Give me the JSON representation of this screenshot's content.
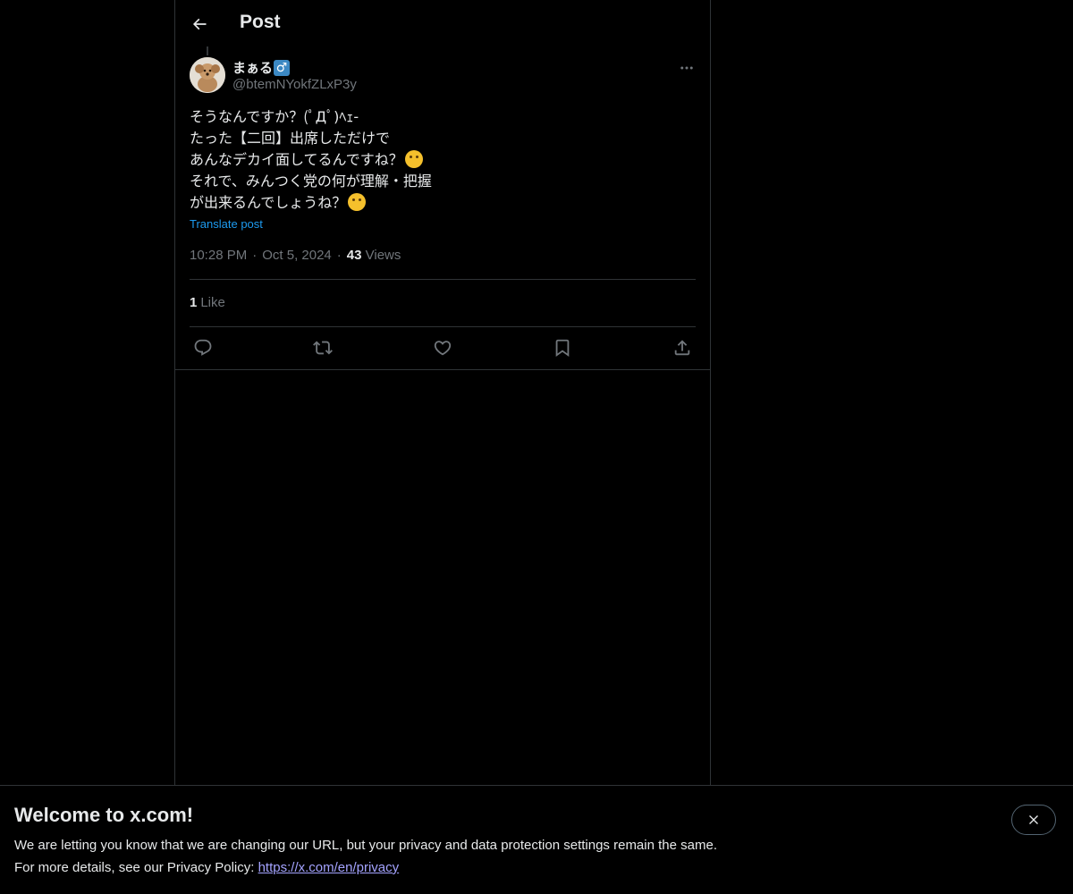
{
  "header": {
    "title": "Post"
  },
  "post": {
    "author": {
      "display_name": "まぁる",
      "badge": "♂",
      "handle": "@btemNYokfZLxP3y"
    },
    "text_lines": [
      "そうなんですか？(ﾟДﾟ)ﾍｪ-",
      "たった【二回】出席しただけで",
      "あんなデカイ面してるんですね？",
      "それで、みんつく党の何が理解・把握",
      "が出来るんでしょうね？"
    ],
    "emojis": {
      "line3": "hand-over-mouth-emoji",
      "line5": "thinking-face-emoji"
    },
    "translate_label": "Translate post",
    "time": "10:28 PM",
    "date": "Oct 5, 2024",
    "separator": "·",
    "views_count": "43",
    "views_label": "Views",
    "likes_count": "1",
    "likes_label": "Like"
  },
  "actions": [
    {
      "name": "reply-icon"
    },
    {
      "name": "repost-icon"
    },
    {
      "name": "like-icon"
    },
    {
      "name": "bookmark-icon"
    },
    {
      "name": "share-icon"
    }
  ],
  "banner": {
    "title": "Welcome to x.com!",
    "line1": "We are letting you know that we are changing our URL, but your privacy and data protection settings remain the same.",
    "line2_prefix": "For more details, see our Privacy Policy: ",
    "link": "https://x.com/en/privacy"
  },
  "colors": {
    "background": "#000000",
    "text": "#e7e9ea",
    "muted": "#71767b",
    "accent": "#1d9bf0",
    "border": "#2f3336",
    "link": "#a4a3ff"
  }
}
